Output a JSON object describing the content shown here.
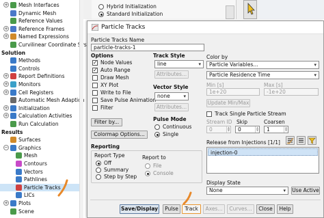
{
  "tree": {
    "items": [
      {
        "label": "Mesh Interfaces",
        "icon": "mesh-interfaces-icon",
        "color": "#4a9a4a"
      },
      {
        "label": "Dynamic Mesh",
        "icon": "dynamic-mesh-icon",
        "color": "#4a78c8"
      },
      {
        "label": "Reference Values",
        "icon": "reference-values-icon",
        "color": "#4a9a4a"
      },
      {
        "label": "Reference Frames",
        "icon": "reference-frames-icon",
        "color": "#4a78c8"
      },
      {
        "label": "Named Expressions",
        "icon": "named-expressions-icon",
        "color": "#d08a2a"
      },
      {
        "label": "Curvilinear Coordinate Syste",
        "icon": "curvilinear-icon",
        "color": "#4a9a4a"
      },
      {
        "label": "Solution",
        "section": true
      },
      {
        "label": "Methods",
        "icon": "methods-icon",
        "color": "#3a7ac8"
      },
      {
        "label": "Controls",
        "icon": "controls-icon",
        "color": "#3a7ac8"
      },
      {
        "label": "Report Definitions",
        "icon": "report-definitions-icon",
        "color": "#d04040"
      },
      {
        "label": "Monitors",
        "icon": "monitors-icon",
        "color": "#3aa0c8"
      },
      {
        "label": "Cell Registers",
        "icon": "cell-registers-icon",
        "color": "#3a7ac8"
      },
      {
        "label": "Automatic Mesh Adaption",
        "icon": "mesh-adaption-icon",
        "color": "#6a6a6a"
      },
      {
        "label": "Initialization",
        "icon": "initialization-icon",
        "color": "#3a7ac8"
      },
      {
        "label": "Calculation Activities",
        "icon": "calculation-activities-icon",
        "color": "#3a7ac8"
      },
      {
        "label": "Run Calculation",
        "icon": "run-calculation-icon",
        "color": "#4a9a4a"
      },
      {
        "label": "Results",
        "section": true
      },
      {
        "label": "Surfaces",
        "icon": "surfaces-icon",
        "color": "#d08a2a"
      },
      {
        "label": "Graphics",
        "icon": "graphics-icon",
        "color": "#3a7ac8"
      },
      {
        "label": "Mesh",
        "icon": "mesh-icon",
        "color": "#4a9a4a"
      },
      {
        "label": "Contours",
        "icon": "contours-icon",
        "color": "#c84ac8"
      },
      {
        "label": "Vectors",
        "icon": "vectors-icon",
        "color": "#3a7ac8"
      },
      {
        "label": "Pathlines",
        "icon": "pathlines-icon",
        "color": "#3a7ac8"
      },
      {
        "label": "Particle Tracks",
        "icon": "particle-tracks-icon",
        "color": "#d04040"
      },
      {
        "label": "LICs",
        "icon": "lics-icon",
        "color": "#3a7ac8"
      },
      {
        "label": "Plots",
        "icon": "plots-icon",
        "color": "#3a7ac8"
      },
      {
        "label": "Scene",
        "icon": "scene-icon",
        "color": "#4a9a4a"
      }
    ]
  },
  "background": {
    "hybrid_label": "Hybrid Initialization",
    "standard_label": "Standard Initialization"
  },
  "dialog": {
    "title": "Particle Tracks",
    "name_label": "Particle Tracks Name",
    "name_value": "particle-tracks-1",
    "options": {
      "heading": "Options",
      "items": [
        {
          "label": "Node Values",
          "checked": true
        },
        {
          "label": "Auto Range",
          "checked": true
        },
        {
          "label": "Draw Mesh",
          "checked": false
        },
        {
          "label": "XY Plot",
          "checked": false
        },
        {
          "label": "Write to File",
          "checked": false
        },
        {
          "label": "Save Pulse Animation",
          "checked": false
        },
        {
          "label": "Filter",
          "checked": false
        }
      ],
      "filter_by_button": "Filter by...",
      "colormap_button": "Colormap Options..."
    },
    "track_style": {
      "heading": "Track Style",
      "value": "line",
      "attributes_button": "Attributes..."
    },
    "vector_style": {
      "heading": "Vector Style",
      "value": "none",
      "attributes_button": "Attributes..."
    },
    "pulse_mode": {
      "heading": "Pulse Mode",
      "continuous": "Continuous",
      "single": "Single",
      "selected": "Single"
    },
    "color_by": {
      "heading": "Color by",
      "category": "Particle Variables...",
      "variable": "Particle Residence Time",
      "min_label": "Min [s]",
      "max_label": "Max [s]",
      "min_value": "1e+20",
      "max_value": "-1e+20",
      "update_button": "Update Min/Max"
    },
    "track_single_label": "Track Single Particle Stream",
    "stream_id_label": "Stream ID",
    "stream_id_value": "0",
    "skip_label": "Skip",
    "skip_value": "0",
    "coarsen_label": "Coarsen",
    "coarsen_value": "1",
    "release_label": "Release from Injections [1/1]",
    "injections": [
      "injection-0"
    ],
    "reporting": {
      "heading": "Reporting",
      "report_type_label": "Report Type",
      "types": [
        "Off",
        "Summary",
        "Step by Step"
      ],
      "selected_type": "Off",
      "report_to_label": "Report to",
      "targets": [
        "File",
        "Console"
      ],
      "selected_target": "Console"
    },
    "display_state": {
      "heading": "Display State",
      "value": "None",
      "use_active_button": "Use Active"
    },
    "buttons": {
      "save_display": "Save/Display",
      "pulse": "Pulse",
      "track": "Track",
      "axes": "Axes...",
      "curves": "Curves...",
      "close": "Close",
      "help": "Help"
    }
  }
}
